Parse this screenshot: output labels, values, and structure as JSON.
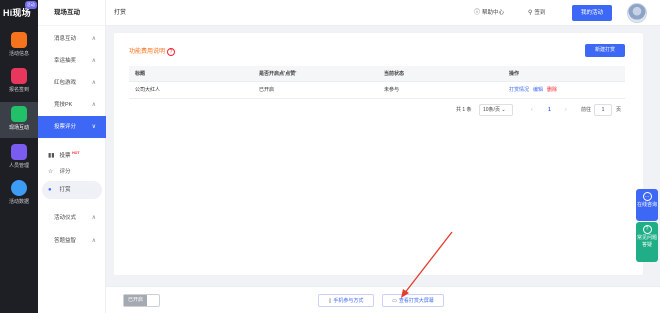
{
  "rail": {
    "logo": "Hi现场",
    "logo_badge": "活动",
    "items": [
      {
        "label": "活动信息",
        "icon": "calendar-icon",
        "color": "#f5731c"
      },
      {
        "label": "报名签到",
        "icon": "signup-icon",
        "color": "#e8375d"
      },
      {
        "label": "现场互动",
        "icon": "interaction-icon",
        "color": "#21c069"
      },
      {
        "label": "人员管理",
        "icon": "people-icon",
        "color": "#7b5cf0"
      },
      {
        "label": "活动数据",
        "icon": "chart-icon",
        "color": "#3d9cf6"
      }
    ]
  },
  "sidebar": {
    "header": "现场互动",
    "items": [
      {
        "label": "消息互动",
        "chevron": "∧"
      },
      {
        "label": "幸运抽奖",
        "chevron": "∧"
      },
      {
        "label": "红包游戏",
        "chevron": "∧"
      },
      {
        "label": "竞技PK",
        "chevron": "∧"
      },
      {
        "label": "投票评分",
        "chevron": "∨"
      },
      {
        "label": "活动仪式",
        "chevron": "∧"
      },
      {
        "label": "答题益智",
        "chevron": "∧"
      }
    ],
    "subitems": [
      {
        "label": "投票",
        "badge": "HOT"
      },
      {
        "label": "评分"
      },
      {
        "label": "打赏"
      }
    ]
  },
  "topbar": {
    "breadcrumb": "打赏",
    "help": "帮助中心",
    "signin": "签到",
    "my_activity": "我的活动"
  },
  "card": {
    "title": "功能费用说明",
    "help_mark": "?",
    "new_button": "新建打赏",
    "table": {
      "headers": [
        "标题",
        "是否开启点'点赞'",
        "当前状态",
        "操作"
      ],
      "rows": [
        {
          "title": "公司大红人",
          "enabled": "已开启",
          "status": "未参与",
          "ops": [
            "打赏情况",
            "编辑",
            "删除"
          ]
        }
      ]
    },
    "pager": {
      "total": "共 1 条",
      "page_size": "10条/页",
      "prev": "‹",
      "current": "1",
      "next": "›",
      "goto_label": "前往",
      "goto_value": "1",
      "page_unit": "页"
    }
  },
  "bottom": {
    "toggle_on": "已开启",
    "mobile_btn": "手机参与方式",
    "screen_btn": "查看打赏大屏幕"
  },
  "floating": {
    "online": "在线咨询",
    "faq": "常见问题答疑"
  },
  "colors": {
    "accent": "#3d68f6",
    "online_bg": "#3d68f6",
    "faq_bg": "#1fae86",
    "arrow": "#e53b2c"
  }
}
